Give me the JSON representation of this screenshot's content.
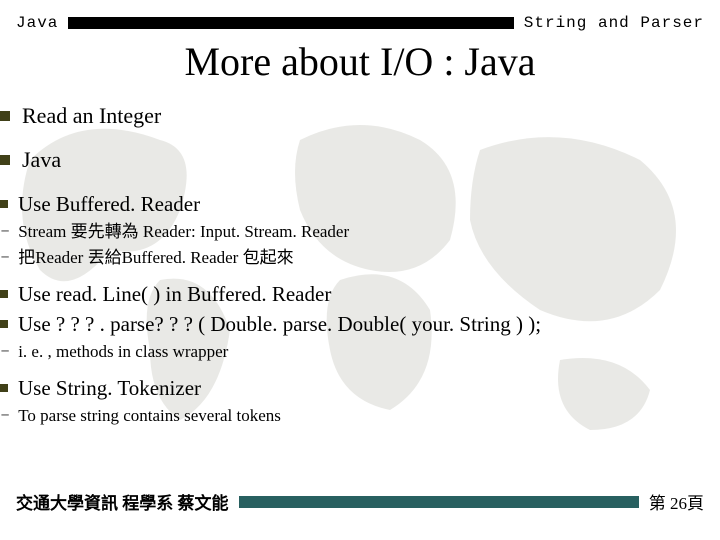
{
  "header": {
    "left": "Java",
    "right": "String and Parser"
  },
  "title": "More about I/O : Java",
  "bullets": {
    "a": "Read an Integer",
    "b": "Java",
    "c": "Use   Buffered. Reader",
    "c1": "Stream 要先轉為 Reader:  Input. Stream. Reader",
    "c2": "把Reader 丟給Buffered. Reader 包起來",
    "d": "Use   read. Line(  )   in  Buffered. Reader",
    "e": "Use   ? ? ? . parse? ? ?   ( Double. parse. Double( your. String ) );",
    "e1": "i. e. , methods in class wrapper",
    "f": "Use   String. Tokenizer",
    "f1": "To parse string contains several tokens"
  },
  "dash": "–",
  "footer": {
    "left": "交通大學資訊 程學系 蔡文能",
    "right": "第 26頁"
  }
}
